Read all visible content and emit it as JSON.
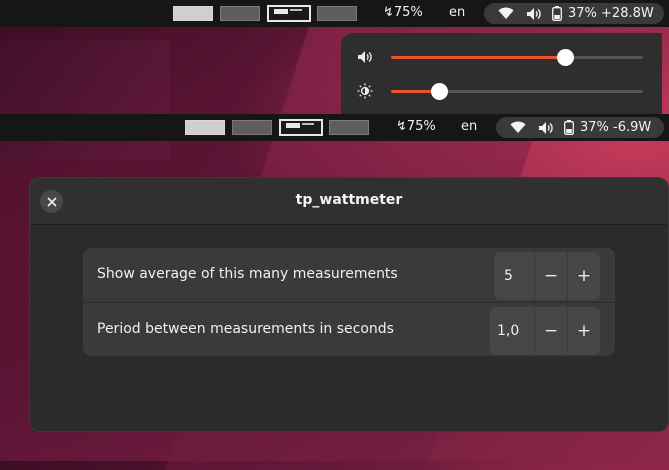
{
  "top_panel": {
    "battery_profile": "↯75%",
    "keyboard_layout": "en",
    "battery_status": "37% +28.8W"
  },
  "second_panel": {
    "battery_profile": "↯75%",
    "keyboard_layout": "en",
    "battery_status": "37% -6.9W"
  },
  "quick_settings": {
    "volume_fraction": 0.69,
    "brightness_fraction": 0.19,
    "accent": "#e9542c"
  },
  "dialog": {
    "title": "tp_wattmeter",
    "rows": [
      {
        "label": "Show average of this many measurements",
        "value": "5",
        "minus": "−",
        "plus": "+"
      },
      {
        "label": "Period between measurements in seconds",
        "value": "1,0",
        "minus": "−",
        "plus": "+"
      }
    ]
  },
  "icons": [
    "close-icon",
    "wifi-icon",
    "speaker-icon",
    "battery-icon",
    "brightness-icon"
  ]
}
